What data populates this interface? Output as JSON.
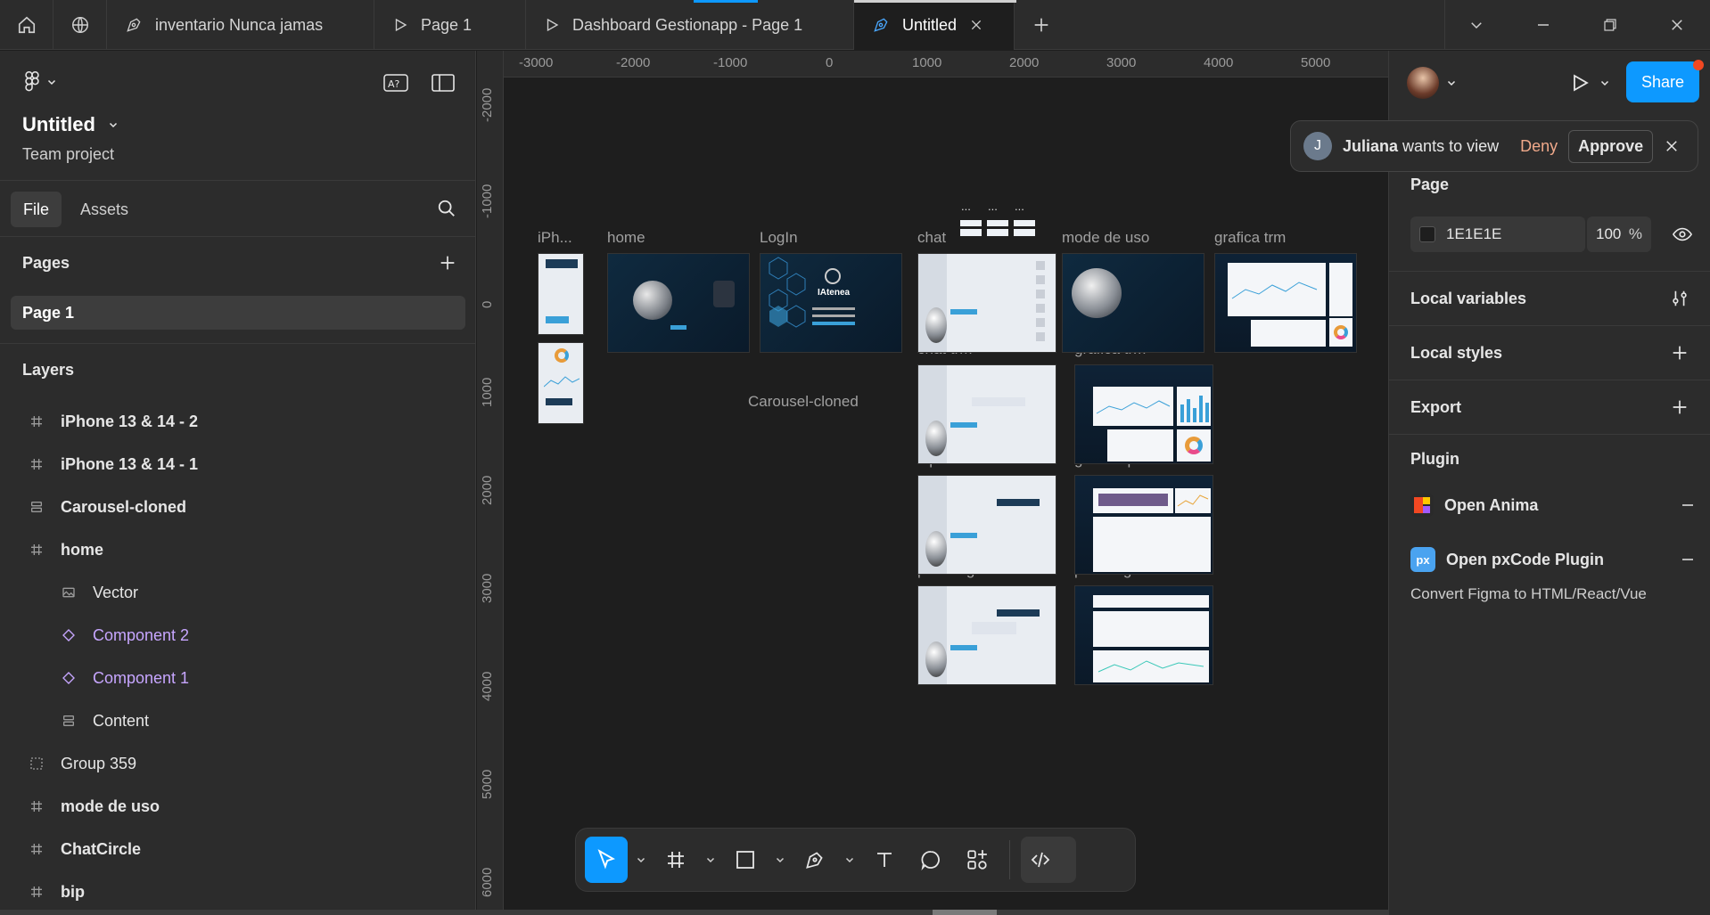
{
  "tabs": [
    {
      "label": "inventario Nunca jamas",
      "icon": "figma-file-icon"
    },
    {
      "label": "Page 1",
      "icon": "play-icon"
    },
    {
      "label": "Dashboard Gestionapp - Page 1",
      "icon": "play-icon"
    },
    {
      "label": "Untitled",
      "icon": "figma-file-icon",
      "active": true
    }
  ],
  "file": {
    "name": "Untitled",
    "project": "Team project"
  },
  "left": {
    "file_tab": "File",
    "assets_tab": "Assets",
    "pages_title": "Pages",
    "pages": [
      "Page 1"
    ],
    "layers_title": "Layers",
    "layers": [
      {
        "label": "iPhone 13 & 14 - 2",
        "icon": "frame-icon",
        "indent": false,
        "bold": true
      },
      {
        "label": "iPhone 13 & 14 - 1",
        "icon": "frame-icon",
        "indent": false,
        "bold": true
      },
      {
        "label": "Carousel-cloned",
        "icon": "auto-layout-icon",
        "indent": false,
        "bold": true
      },
      {
        "label": "home",
        "icon": "frame-icon",
        "indent": false,
        "bold": true
      },
      {
        "label": "Vector",
        "icon": "image-icon",
        "indent": true,
        "bold": false
      },
      {
        "label": "Component 2",
        "icon": "instance-icon",
        "indent": true,
        "bold": false,
        "component": true
      },
      {
        "label": "Component 1",
        "icon": "instance-icon",
        "indent": true,
        "bold": false,
        "component": true
      },
      {
        "label": "Content",
        "icon": "auto-layout-icon",
        "indent": true,
        "bold": false
      },
      {
        "label": "Group 359",
        "icon": "group-icon",
        "indent": false,
        "bold": false
      },
      {
        "label": "mode de uso",
        "icon": "frame-icon",
        "indent": false,
        "bold": true
      },
      {
        "label": "ChatCircle",
        "icon": "frame-icon",
        "indent": false,
        "bold": true
      },
      {
        "label": "bip",
        "icon": "frame-icon",
        "indent": false,
        "bold": true
      }
    ]
  },
  "ruler": {
    "x": [
      "-3000",
      "-2000",
      "-1000",
      "0",
      "1000",
      "2000",
      "3000",
      "4000",
      "5000"
    ],
    "y": [
      "-2000",
      "-1000",
      "0",
      "1000",
      "2000",
      "3000",
      "4000",
      "5000",
      "6000"
    ]
  },
  "canvas": {
    "frames": [
      {
        "label": "iPh..."
      },
      {
        "label": "home"
      },
      {
        "label": "LogIn"
      },
      {
        "label": "chat"
      },
      {
        "label": "mode de uso"
      },
      {
        "label": "grafica trm"
      },
      {
        "label": "chat trm"
      },
      {
        "label": "grafica trm"
      },
      {
        "label": "bip"
      },
      {
        "label": "grafica ipc"
      },
      {
        "label": "paca algodon chat"
      },
      {
        "label": "paca algodon"
      }
    ],
    "carousel_label": "Carousel-cloned",
    "login_brand": "IAtenea",
    "ellipsis": "..."
  },
  "right": {
    "share": "Share",
    "notification": {
      "initial": "J",
      "name": "Juliana",
      "text": "wants to view",
      "deny": "Deny",
      "approve": "Approve"
    },
    "page_title": "Page",
    "page_color": "1E1E1E",
    "page_opacity": "100",
    "percent": "%",
    "local_variables": "Local variables",
    "local_styles": "Local styles",
    "export": "Export",
    "plugin_title": "Plugin",
    "plugins": [
      {
        "name": "Open Anima",
        "desc": ""
      },
      {
        "name": "Open pxCode Plugin",
        "desc": "Convert Figma to HTML/React/Vue"
      }
    ],
    "help": "?"
  },
  "colors": {
    "accent": "#0d99ff",
    "component": "#c7a6ff",
    "deny": "#f0a98a",
    "bg": "#1e1e1e"
  }
}
